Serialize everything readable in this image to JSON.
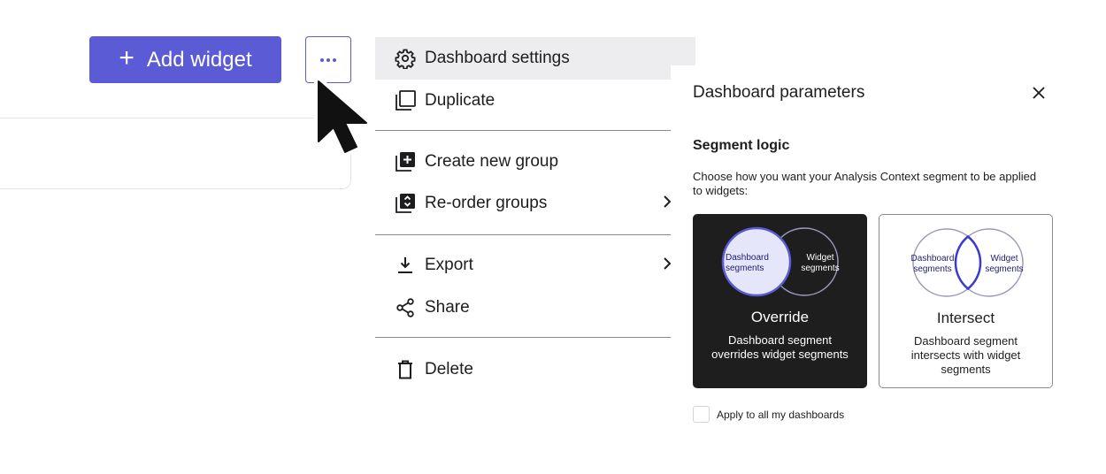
{
  "toolbar": {
    "add_widget_label": "Add widget",
    "add_widget_icon": "plus-icon",
    "more_icon": "more-horizontal-icon"
  },
  "menu": {
    "items": [
      {
        "label": "Dashboard settings",
        "icon": "gear-icon",
        "highlighted": true
      },
      {
        "label": "Duplicate",
        "icon": "duplicate-icon"
      },
      {
        "label": "Create new group",
        "icon": "add-group-icon"
      },
      {
        "label": "Re-order groups",
        "icon": "reorder-groups-icon",
        "submenu": true
      },
      {
        "label": "Export",
        "icon": "download-icon",
        "submenu": true
      },
      {
        "label": "Share",
        "icon": "share-icon"
      },
      {
        "label": "Delete",
        "icon": "trash-icon"
      }
    ]
  },
  "panel": {
    "title": "Dashboard parameters",
    "close_icon": "close-icon",
    "segment_heading": "Segment logic",
    "segment_description": "Choose how you want your Analysis Context segment to be applied to widgets:",
    "options": [
      {
        "title": "Override",
        "description": "Dashboard segment overrides widget segments",
        "circle_left": "Dashboard segments",
        "circle_right": "Widget segments",
        "selected": true
      },
      {
        "title": "Intersect",
        "description": "Dashboard segment intersects with widget segments",
        "circle_left": "Dashboard segments",
        "circle_right": "Widget segments",
        "selected": false
      }
    ],
    "apply_all_label": "Apply to all my dashboards",
    "apply_all_checked": false
  },
  "colors": {
    "accent": "#5b5bd6",
    "menu_highlight": "#ededf0",
    "card_dark": "#1e1e1e",
    "circle_fill": "#e6e6fa",
    "intersect_stroke": "#3a3ad0"
  }
}
